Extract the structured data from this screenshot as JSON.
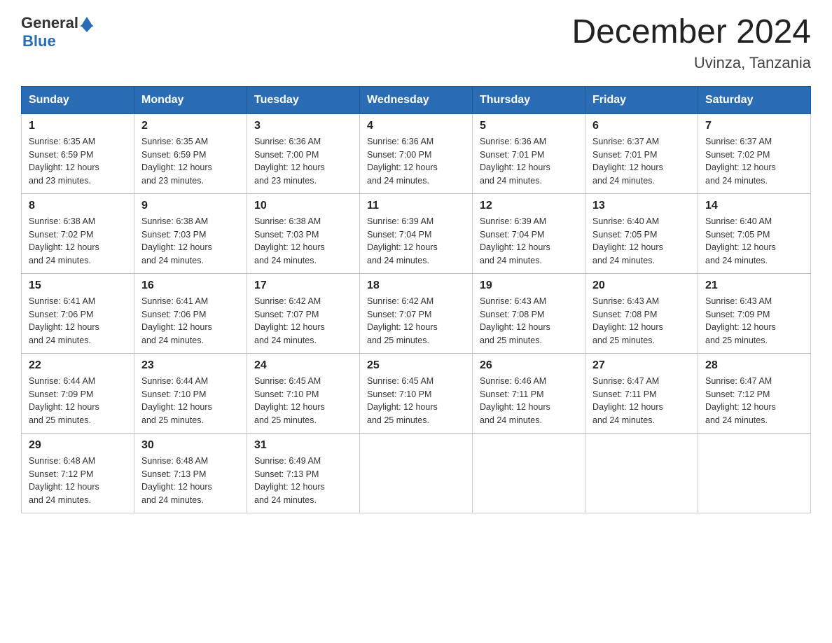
{
  "header": {
    "logo_text_general": "General",
    "logo_text_blue": "Blue",
    "month_title": "December 2024",
    "location": "Uvinza, Tanzania"
  },
  "days_of_week": [
    "Sunday",
    "Monday",
    "Tuesday",
    "Wednesday",
    "Thursday",
    "Friday",
    "Saturday"
  ],
  "weeks": [
    [
      {
        "day": "1",
        "sunrise": "6:35 AM",
        "sunset": "6:59 PM",
        "daylight": "12 hours and 23 minutes."
      },
      {
        "day": "2",
        "sunrise": "6:35 AM",
        "sunset": "6:59 PM",
        "daylight": "12 hours and 23 minutes."
      },
      {
        "day": "3",
        "sunrise": "6:36 AM",
        "sunset": "7:00 PM",
        "daylight": "12 hours and 23 minutes."
      },
      {
        "day": "4",
        "sunrise": "6:36 AM",
        "sunset": "7:00 PM",
        "daylight": "12 hours and 24 minutes."
      },
      {
        "day": "5",
        "sunrise": "6:36 AM",
        "sunset": "7:01 PM",
        "daylight": "12 hours and 24 minutes."
      },
      {
        "day": "6",
        "sunrise": "6:37 AM",
        "sunset": "7:01 PM",
        "daylight": "12 hours and 24 minutes."
      },
      {
        "day": "7",
        "sunrise": "6:37 AM",
        "sunset": "7:02 PM",
        "daylight": "12 hours and 24 minutes."
      }
    ],
    [
      {
        "day": "8",
        "sunrise": "6:38 AM",
        "sunset": "7:02 PM",
        "daylight": "12 hours and 24 minutes."
      },
      {
        "day": "9",
        "sunrise": "6:38 AM",
        "sunset": "7:03 PM",
        "daylight": "12 hours and 24 minutes."
      },
      {
        "day": "10",
        "sunrise": "6:38 AM",
        "sunset": "7:03 PM",
        "daylight": "12 hours and 24 minutes."
      },
      {
        "day": "11",
        "sunrise": "6:39 AM",
        "sunset": "7:04 PM",
        "daylight": "12 hours and 24 minutes."
      },
      {
        "day": "12",
        "sunrise": "6:39 AM",
        "sunset": "7:04 PM",
        "daylight": "12 hours and 24 minutes."
      },
      {
        "day": "13",
        "sunrise": "6:40 AM",
        "sunset": "7:05 PM",
        "daylight": "12 hours and 24 minutes."
      },
      {
        "day": "14",
        "sunrise": "6:40 AM",
        "sunset": "7:05 PM",
        "daylight": "12 hours and 24 minutes."
      }
    ],
    [
      {
        "day": "15",
        "sunrise": "6:41 AM",
        "sunset": "7:06 PM",
        "daylight": "12 hours and 24 minutes."
      },
      {
        "day": "16",
        "sunrise": "6:41 AM",
        "sunset": "7:06 PM",
        "daylight": "12 hours and 24 minutes."
      },
      {
        "day": "17",
        "sunrise": "6:42 AM",
        "sunset": "7:07 PM",
        "daylight": "12 hours and 24 minutes."
      },
      {
        "day": "18",
        "sunrise": "6:42 AM",
        "sunset": "7:07 PM",
        "daylight": "12 hours and 25 minutes."
      },
      {
        "day": "19",
        "sunrise": "6:43 AM",
        "sunset": "7:08 PM",
        "daylight": "12 hours and 25 minutes."
      },
      {
        "day": "20",
        "sunrise": "6:43 AM",
        "sunset": "7:08 PM",
        "daylight": "12 hours and 25 minutes."
      },
      {
        "day": "21",
        "sunrise": "6:43 AM",
        "sunset": "7:09 PM",
        "daylight": "12 hours and 25 minutes."
      }
    ],
    [
      {
        "day": "22",
        "sunrise": "6:44 AM",
        "sunset": "7:09 PM",
        "daylight": "12 hours and 25 minutes."
      },
      {
        "day": "23",
        "sunrise": "6:44 AM",
        "sunset": "7:10 PM",
        "daylight": "12 hours and 25 minutes."
      },
      {
        "day": "24",
        "sunrise": "6:45 AM",
        "sunset": "7:10 PM",
        "daylight": "12 hours and 25 minutes."
      },
      {
        "day": "25",
        "sunrise": "6:45 AM",
        "sunset": "7:10 PM",
        "daylight": "12 hours and 25 minutes."
      },
      {
        "day": "26",
        "sunrise": "6:46 AM",
        "sunset": "7:11 PM",
        "daylight": "12 hours and 24 minutes."
      },
      {
        "day": "27",
        "sunrise": "6:47 AM",
        "sunset": "7:11 PM",
        "daylight": "12 hours and 24 minutes."
      },
      {
        "day": "28",
        "sunrise": "6:47 AM",
        "sunset": "7:12 PM",
        "daylight": "12 hours and 24 minutes."
      }
    ],
    [
      {
        "day": "29",
        "sunrise": "6:48 AM",
        "sunset": "7:12 PM",
        "daylight": "12 hours and 24 minutes."
      },
      {
        "day": "30",
        "sunrise": "6:48 AM",
        "sunset": "7:13 PM",
        "daylight": "12 hours and 24 minutes."
      },
      {
        "day": "31",
        "sunrise": "6:49 AM",
        "sunset": "7:13 PM",
        "daylight": "12 hours and 24 minutes."
      },
      null,
      null,
      null,
      null
    ]
  ],
  "labels": {
    "sunrise": "Sunrise:",
    "sunset": "Sunset:",
    "daylight": "Daylight:"
  }
}
